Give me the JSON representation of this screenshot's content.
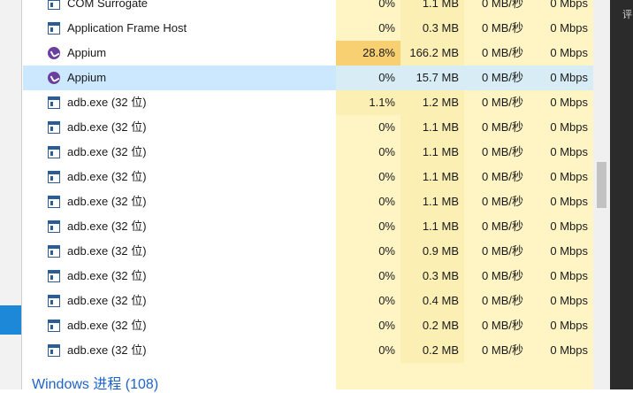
{
  "rows": [
    {
      "name": "COM Surrogate",
      "icon": "window-icon",
      "cpu": "0%",
      "mem": "1.1 MB",
      "disk": "0 MB/秒",
      "net": "0 Mbps"
    },
    {
      "name": "Application Frame Host",
      "icon": "window-icon",
      "cpu": "0%",
      "mem": "0.3 MB",
      "disk": "0 MB/秒",
      "net": "0 Mbps"
    },
    {
      "name": "Appium",
      "icon": "appium-icon",
      "cpu": "28.8%",
      "mem": "166.2 MB",
      "disk": "0 MB/秒",
      "net": "0 Mbps"
    },
    {
      "name": "Appium",
      "icon": "appium-icon",
      "cpu": "0%",
      "mem": "15.7 MB",
      "disk": "0 MB/秒",
      "net": "0 Mbps",
      "selected": true
    },
    {
      "name": "adb.exe (32 位)",
      "icon": "window-icon",
      "cpu": "1.1%",
      "mem": "1.2 MB",
      "disk": "0 MB/秒",
      "net": "0 Mbps"
    },
    {
      "name": "adb.exe (32 位)",
      "icon": "window-icon",
      "cpu": "0%",
      "mem": "1.1 MB",
      "disk": "0 MB/秒",
      "net": "0 Mbps"
    },
    {
      "name": "adb.exe (32 位)",
      "icon": "window-icon",
      "cpu": "0%",
      "mem": "1.1 MB",
      "disk": "0 MB/秒",
      "net": "0 Mbps"
    },
    {
      "name": "adb.exe (32 位)",
      "icon": "window-icon",
      "cpu": "0%",
      "mem": "1.1 MB",
      "disk": "0 MB/秒",
      "net": "0 Mbps"
    },
    {
      "name": "adb.exe (32 位)",
      "icon": "window-icon",
      "cpu": "0%",
      "mem": "1.1 MB",
      "disk": "0 MB/秒",
      "net": "0 Mbps"
    },
    {
      "name": "adb.exe (32 位)",
      "icon": "window-icon",
      "cpu": "0%",
      "mem": "1.1 MB",
      "disk": "0 MB/秒",
      "net": "0 Mbps"
    },
    {
      "name": "adb.exe (32 位)",
      "icon": "window-icon",
      "cpu": "0%",
      "mem": "0.9 MB",
      "disk": "0 MB/秒",
      "net": "0 Mbps"
    },
    {
      "name": "adb.exe (32 位)",
      "icon": "window-icon",
      "cpu": "0%",
      "mem": "0.3 MB",
      "disk": "0 MB/秒",
      "net": "0 Mbps"
    },
    {
      "name": "adb.exe (32 位)",
      "icon": "window-icon",
      "cpu": "0%",
      "mem": "0.4 MB",
      "disk": "0 MB/秒",
      "net": "0 Mbps"
    },
    {
      "name": "adb.exe (32 位)",
      "icon": "window-icon",
      "cpu": "0%",
      "mem": "0.2 MB",
      "disk": "0 MB/秒",
      "net": "0 Mbps"
    },
    {
      "name": "adb.exe (32 位)",
      "icon": "window-icon",
      "cpu": "0%",
      "mem": "0.2 MB",
      "disk": "0 MB/秒",
      "net": "0 Mbps"
    }
  ],
  "group": {
    "label": "Windows 进程 (108)"
  },
  "right_panel": {
    "text": "评"
  },
  "colors": {
    "heat_light": "#fff4c4",
    "heat_medium": "#fcefb4",
    "heat_high": "#f9d071",
    "selection": "#cce8ff",
    "group_text": "#1e64c8"
  }
}
